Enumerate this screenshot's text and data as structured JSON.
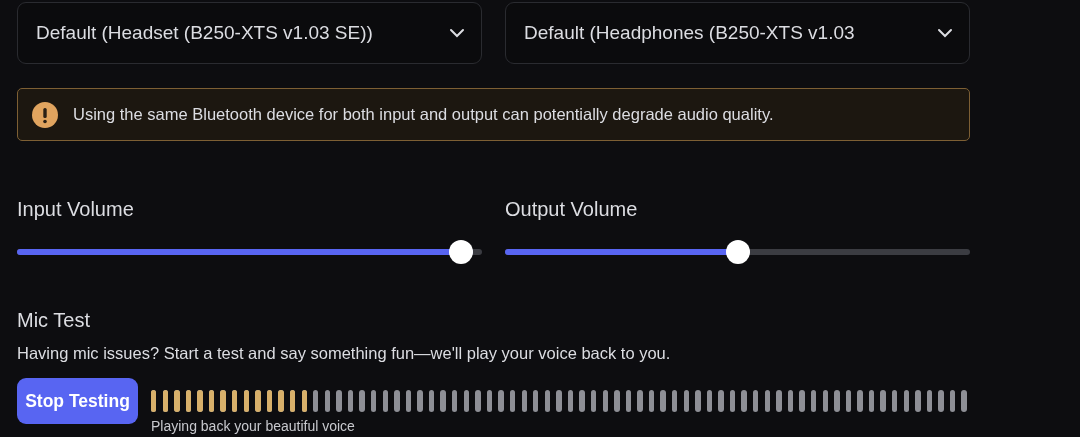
{
  "devices": [
    {
      "value": "Default (Headset (B250-XTS v1.03 SE))"
    },
    {
      "value": "Default (Headphones (B250-XTS v1.03"
    }
  ],
  "warning": {
    "text": "Using the same Bluetooth device for both input and output can potentially degrade audio quality."
  },
  "volumes": [
    {
      "label": "Input Volume",
      "level": 0.98
    },
    {
      "label": "Output Volume",
      "level": 0.5
    }
  ],
  "mic_test": {
    "title": "Mic Test",
    "description": "Having mic issues? Start a test and say something fun—we'll play your voice back to you.",
    "button": "Stop Testing",
    "status": "Playing back your beautiful voice"
  }
}
